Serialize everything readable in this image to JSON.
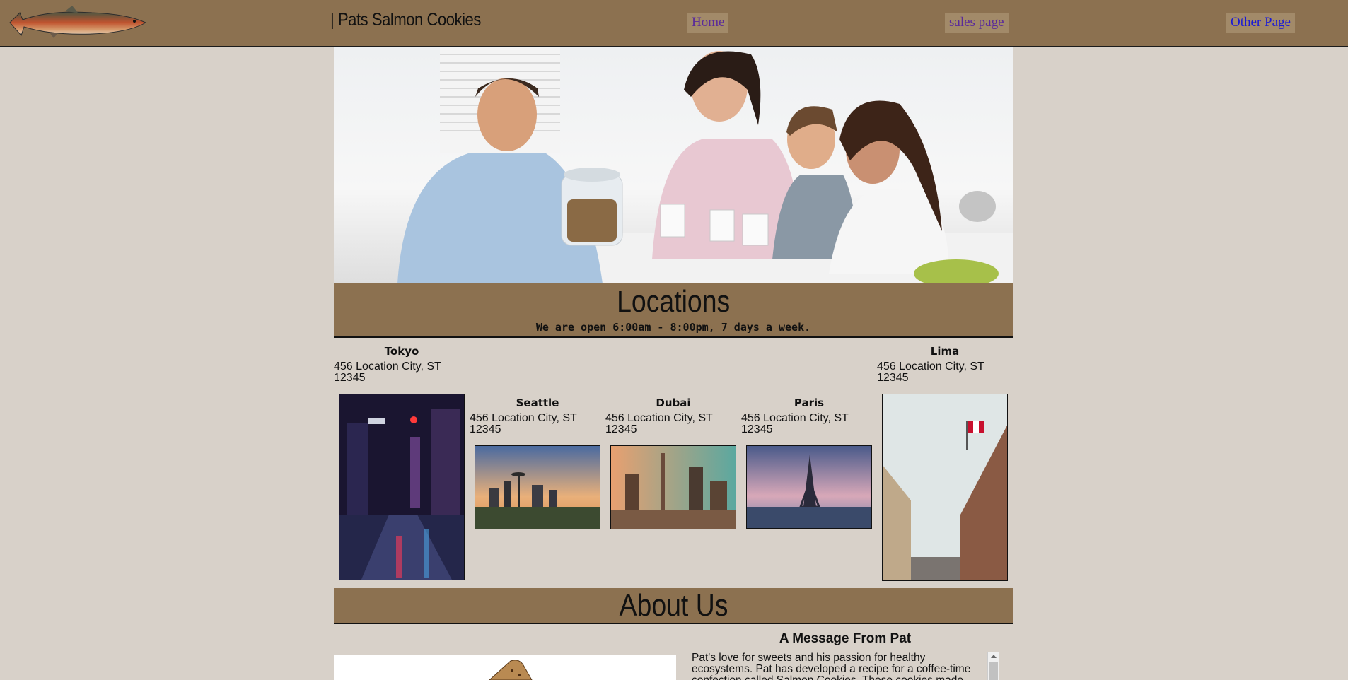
{
  "header": {
    "brand": "| Pats Salmon Cookies",
    "nav": {
      "home": "Home",
      "sales": "sales page",
      "other": "Other Page"
    }
  },
  "locations": {
    "title": "Locations",
    "hours": "We are open 6:00am - 8:00pm, 7 days a week.",
    "stores": [
      {
        "name": "Tokyo",
        "address": "456 Location City, ST 12345"
      },
      {
        "name": "Seattle",
        "address": "456 Location City, ST 12345"
      },
      {
        "name": "Dubai",
        "address": "456 Location City, ST 12345"
      },
      {
        "name": "Paris",
        "address": "456 Location City, ST 12345"
      },
      {
        "name": "Lima",
        "address": "456 Location City, ST 12345"
      }
    ]
  },
  "about": {
    "title": "About Us",
    "message_title": "A Message From Pat",
    "message_text": "Pat's love for sweets and his passion for healthy ecosystems. Pat has developed a recipe for a coffee-time confection called Salmon Cookies. These cookies made"
  },
  "colors": {
    "page_bg": "#d8d1c9",
    "band": "#8c7150",
    "nav_button": "#a28a69",
    "link_visited": "#5a2a9a",
    "link": "#1a1ad6"
  }
}
